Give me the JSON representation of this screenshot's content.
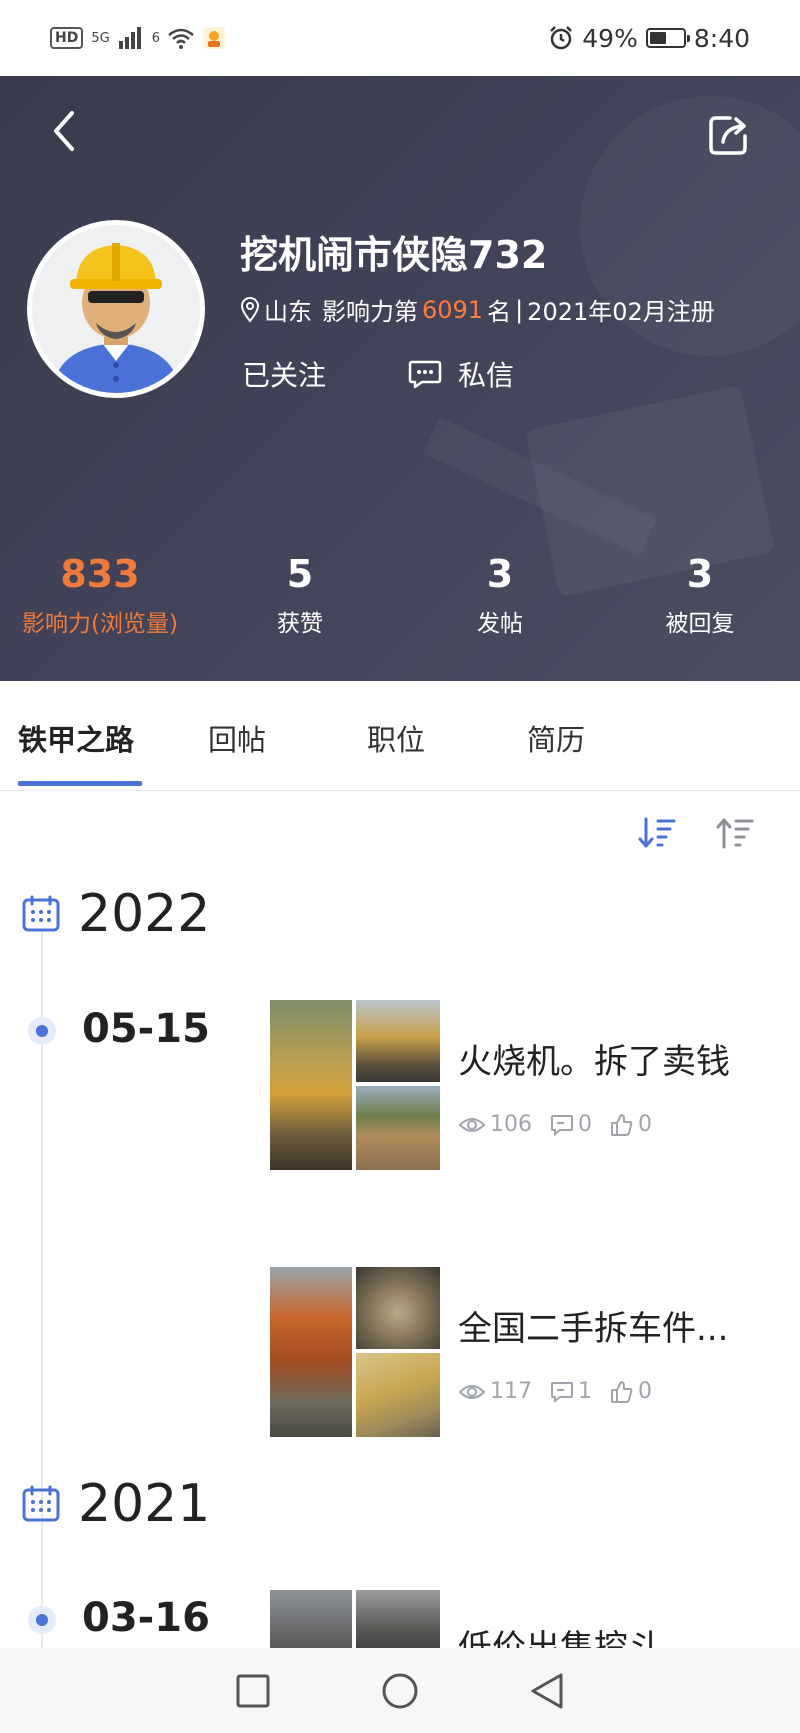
{
  "status_bar": {
    "left_badge": "HD",
    "network": "5G",
    "wifi_label": "6",
    "battery": "49%",
    "time": "8:40",
    "battery_level": 0.49
  },
  "profile": {
    "name": "挖机闹市侠隐732",
    "location": "山东",
    "influence_prefix": "影响力第",
    "rank": "6091",
    "influence_suffix": "名",
    "separator": "|",
    "registered": "2021年02月注册",
    "follow_label": "已关注",
    "message_label": "私信"
  },
  "stats": [
    {
      "value": "833",
      "label": "影响力(浏览量)"
    },
    {
      "value": "5",
      "label": "获赞"
    },
    {
      "value": "3",
      "label": "发帖"
    },
    {
      "value": "3",
      "label": "被回复"
    }
  ],
  "tabs": [
    {
      "label": "铁甲之路",
      "active": true
    },
    {
      "label": "回帖",
      "active": false
    },
    {
      "label": "职位",
      "active": false
    },
    {
      "label": "简历",
      "active": false
    }
  ],
  "timeline": {
    "years": [
      "2022",
      "2021"
    ],
    "dates": [
      "05-15",
      "03-16"
    ],
    "posts": [
      {
        "title": "火烧机。拆了卖钱",
        "views": "106",
        "comments": "0",
        "likes": "0"
      },
      {
        "title": "全国二手拆车件...",
        "views": "117",
        "comments": "1",
        "likes": "0"
      },
      {
        "title": "低价出售挖斗",
        "views": "",
        "comments": "",
        "likes": ""
      }
    ]
  },
  "colors": {
    "accent_blue": "#4a72d8",
    "orange": "#f07a3a",
    "header_bg": "#3f4054"
  },
  "icons": [
    "back-arrow-icon",
    "share-icon",
    "location-pin-icon",
    "message-icon",
    "calendar-icon",
    "sort-desc-icon",
    "sort-asc-icon",
    "eye-icon",
    "comment-icon",
    "thumbs-up-icon",
    "nav-square-icon",
    "nav-circle-icon",
    "nav-triangle-icon"
  ]
}
